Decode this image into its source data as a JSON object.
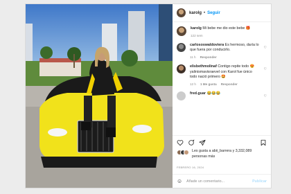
{
  "post": {
    "username": "karolg",
    "follow_label": "Seguir",
    "separator": "•"
  },
  "caption": {
    "username": "karolg",
    "text": "Mi bebe me dio este bebe 🎁",
    "time": "122 sem"
  },
  "comments": [
    {
      "username": "carlososwaldoviera",
      "text": "Es hermoso, daría lo que fuera por conducirlo.",
      "time": "11 h",
      "reply_label": "Responder",
      "likes": ""
    },
    {
      "username": "elisbethmolinaf",
      "text": "Contigo repite todo 😍yalinismavisraevel con Karol fue único todo nació primero 🤩",
      "time": "12 h",
      "likes": "1 Me gusta",
      "reply_label": "Responder"
    },
    {
      "username": "fred.guar",
      "text": "😂😂😂",
      "time": "",
      "reply_label": "",
      "likes": ""
    }
  ],
  "likes_text": "Les gusta a abii_barrera y 3,332,089 personas más",
  "date": "FEBRERO 16, 2024",
  "add_comment": {
    "placeholder": "Añade un comentario...",
    "publish_label": "Publicar"
  },
  "icons": [
    "heart-icon",
    "comment-icon",
    "share-icon",
    "bookmark-icon",
    "emoji-icon"
  ],
  "colors": {
    "accent": "#0095f6",
    "car": "#f1e21b"
  }
}
